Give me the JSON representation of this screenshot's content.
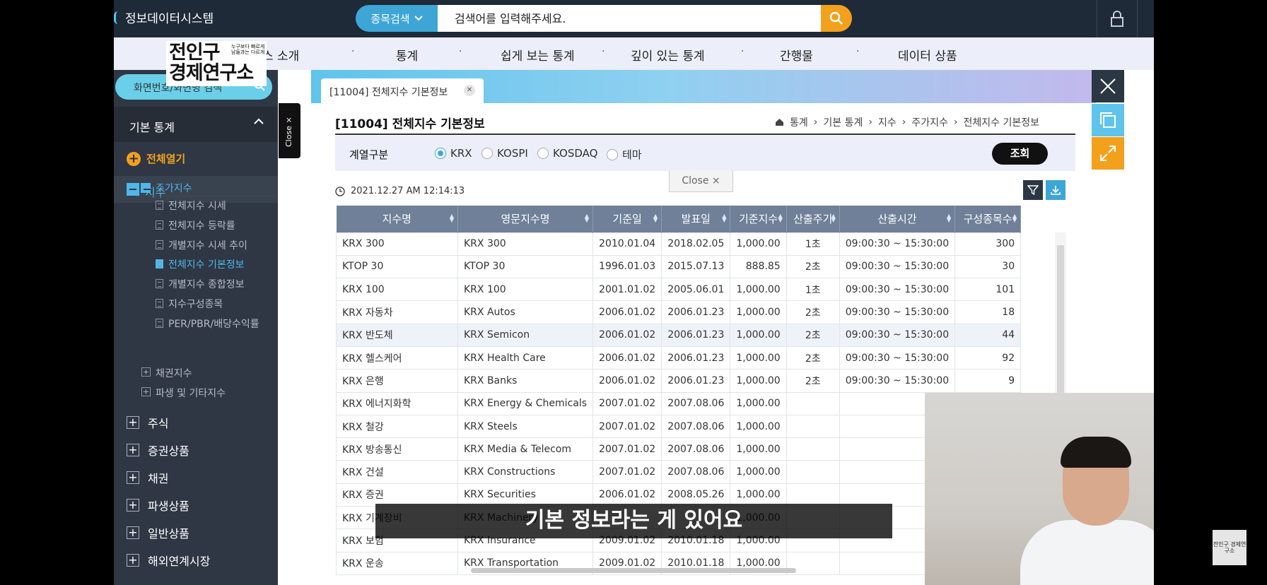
{
  "app": {
    "title": "정보데이터시스템"
  },
  "search": {
    "type_label": "종목검색",
    "placeholder": "검색어를 입력해주세요."
  },
  "menu": [
    "스 소개",
    "통계",
    "쉽게 보는 통계",
    "깊이 있는 통계",
    "간행물",
    "데이터 상품"
  ],
  "brand": {
    "line1": "전인구",
    "line2": "경제연구소",
    "tagline": "누구보다 빠르게 남들과는 다르게"
  },
  "sidebar": {
    "screen_search": "화면번호/화면명 검색",
    "section": "기본 통계",
    "open_all": "전체열기",
    "index": "지수",
    "stock_index": "주가지수",
    "children": [
      "전체지수 시세",
      "전체지수 등락률",
      "개별지수 시세 추이",
      "전체지수 기본정보",
      "개별지수 종합정보",
      "지수구성종목",
      "PER/PBR/배당수익률"
    ],
    "active_child": 3,
    "sub_groups": [
      "채권지수",
      "파생 및 기타지수"
    ],
    "categories": [
      "주식",
      "증권상품",
      "채권",
      "파생상품",
      "일반상품",
      "해외연계시장"
    ],
    "close_tab": "Close ×"
  },
  "tab": {
    "label": "[11004] 전체지수 기본정보"
  },
  "page": {
    "title": "[11004] 전체지수 기본정보",
    "breadcrumb": [
      "통계",
      "기본 통계",
      "지수",
      "주가지수",
      "전체지수 기본정보"
    ],
    "filter_label": "계열구분",
    "radios": [
      "KRX",
      "KOSPI",
      "KOSDAQ",
      "테마"
    ],
    "selected_radio": "KRX",
    "query_label": "조회",
    "close_pill": "Close ×",
    "timestamp": "2021.12.27 AM 12:14:13"
  },
  "table": {
    "columns": [
      "지수명",
      "영문지수명",
      "기준일",
      "발표일",
      "기준지수",
      "산출주기",
      "산출시간",
      "구성종목수"
    ],
    "rows": [
      [
        "KRX 300",
        "KRX 300",
        "2010.01.04",
        "2018.02.05",
        "1,000.00",
        "1초",
        "09:00:30 ~ 15:30:00",
        "300"
      ],
      [
        "KTOP 30",
        "KTOP 30",
        "1996.01.03",
        "2015.07.13",
        "888.85",
        "2초",
        "09:00:30 ~ 15:30:00",
        "30"
      ],
      [
        "KRX 100",
        "KRX 100",
        "2001.01.02",
        "2005.06.01",
        "1,000.00",
        "1초",
        "09:00:30 ~ 15:30:00",
        "101"
      ],
      [
        "KRX 자동차",
        "KRX Autos",
        "2006.01.02",
        "2006.01.23",
        "1,000.00",
        "2초",
        "09:00:30 ~ 15:30:00",
        "18"
      ],
      [
        "KRX 반도체",
        "KRX Semicon",
        "2006.01.02",
        "2006.01.23",
        "1,000.00",
        "2초",
        "09:00:30 ~ 15:30:00",
        "44"
      ],
      [
        "KRX 헬스케어",
        "KRX Health Care",
        "2006.01.02",
        "2006.01.23",
        "1,000.00",
        "2초",
        "09:00:30 ~ 15:30:00",
        "92"
      ],
      [
        "KRX 은행",
        "KRX Banks",
        "2006.01.02",
        "2006.01.23",
        "1,000.00",
        "2초",
        "09:00:30 ~ 15:30:00",
        "9"
      ],
      [
        "KRX 에너지화학",
        "KRX Energy & Chemicals",
        "2007.01.02",
        "2007.08.06",
        "1,000.00",
        "",
        "",
        ""
      ],
      [
        "KRX 철강",
        "KRX Steels",
        "2007.01.02",
        "2007.08.06",
        "1,000.00",
        "",
        "",
        ""
      ],
      [
        "KRX 방송통신",
        "KRX Media & Telecom",
        "2007.01.02",
        "2007.08.06",
        "1,000.00",
        "",
        "",
        ""
      ],
      [
        "KRX 건설",
        "KRX Constructions",
        "2007.01.02",
        "2007.08.06",
        "1,000.00",
        "",
        "",
        ""
      ],
      [
        "KRX 증권",
        "KRX Securities",
        "2006.01.02",
        "2008.05.26",
        "1,000.00",
        "",
        "",
        ""
      ],
      [
        "KRX 기계장비",
        "KRX Machinery",
        "",
        "",
        "1,000.00",
        "",
        "",
        ""
      ],
      [
        "KRX 보험",
        "KRX Insurance",
        "2009.01.02",
        "2010.01.18",
        "1,000.00",
        "",
        "",
        ""
      ],
      [
        "KRX 운송",
        "KRX Transportation",
        "2009.01.02",
        "2010.01.18",
        "1,000.00",
        "",
        "",
        ""
      ]
    ],
    "highlighted_row": 4
  },
  "subtitle": "기본 정보라는 게 있어요",
  "watermark": "전인구 경제연구소",
  "colors": {
    "topbar": "#1e2a38",
    "accent_blue": "#3ea6d6",
    "accent_orange": "#f3a11c",
    "sidebar": "#2f3744"
  }
}
